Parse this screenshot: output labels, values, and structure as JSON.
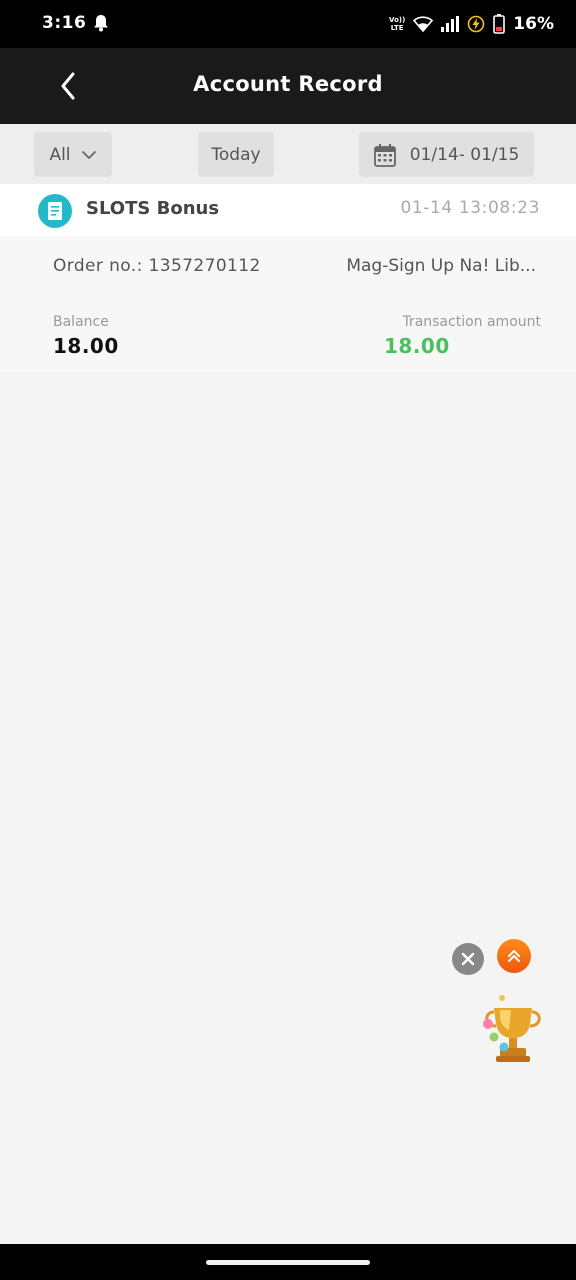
{
  "status_bar": {
    "time": "3:16",
    "volte_top": "Vo))",
    "volte_bottom": "LTE",
    "battery_percent": "16%"
  },
  "header": {
    "title": "Account Record"
  },
  "filters": {
    "type_label": "All",
    "period_label": "Today",
    "date_range": "01/14- 01/15"
  },
  "record": {
    "type": "SLOTS Bonus",
    "timestamp": "01-14 13:08:23",
    "order_no": "Order no.: 1357270112",
    "description": "Mag-Sign Up Na! Lib...",
    "balance_label": "Balance",
    "balance_value": "18.00",
    "amount_label": "Transaction amount",
    "amount_value": "18.00"
  },
  "colors": {
    "header_bg": "#1a1a1a",
    "amount_positive": "#48c15c",
    "record_icon": "#23b9c9",
    "float_accent": "#f26a10"
  },
  "icons": {
    "back": "chevron-left-icon",
    "dropdown": "chevron-down-icon",
    "calendar": "calendar-icon",
    "record": "receipt-icon",
    "close": "close-icon",
    "scroll_top": "double-chevron-up-icon",
    "promo": "trophy-icon"
  }
}
